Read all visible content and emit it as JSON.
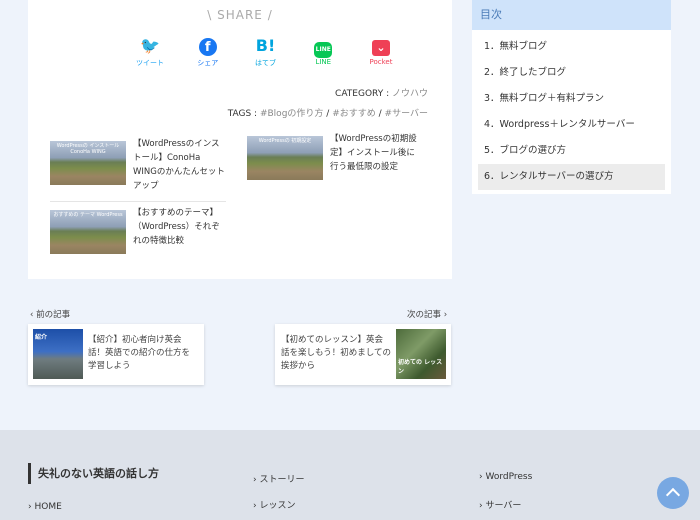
{
  "share": {
    "title": "\\ SHARE /",
    "buttons": [
      {
        "label": "ツイート",
        "icon": "twitter-icon",
        "glyph": "🐦"
      },
      {
        "label": "シェア",
        "icon": "facebook-icon",
        "glyph": "f"
      },
      {
        "label": "はてブ",
        "icon": "hatena-bookmark-icon",
        "glyph": "B!"
      },
      {
        "label": "LINE",
        "icon": "line-icon",
        "glyph": "LINE"
      },
      {
        "label": "Pocket",
        "icon": "pocket-icon",
        "glyph": "⌄"
      }
    ]
  },
  "category": {
    "label": "CATEGORY :",
    "value": "ノウハウ"
  },
  "tags": {
    "label": "TAGS :",
    "items": [
      "#Blogの作り方",
      "#おすすめ",
      "#サーバー"
    ],
    "separator": "/"
  },
  "related": [
    {
      "thumb_caption": "WordPressの インストール ConoHa WING",
      "title": "【WordPressのインストール】ConoHa WINGのかんたんセットアップ"
    },
    {
      "thumb_caption": "WordPressの 初期設定",
      "title": "【WordPressの初期設定】インストール後に行う最低限の設定"
    },
    {
      "thumb_caption": "おすすめの テーマ WordPress",
      "title": "【おすすめのテーマ】（WordPress）それぞれの特徴比較"
    }
  ],
  "post_nav": {
    "prev": {
      "label": "前の記事",
      "thumb_caption": "紹介",
      "title": "【紹介】初心者向け英会話！英語での紹介の仕方を学習しよう"
    },
    "next": {
      "label": "次の記事",
      "thumb_caption": "初めての レッスン",
      "title": "【初めてのレッスン】英会話を楽しもう！初めましての挨拶から"
    }
  },
  "toc": {
    "title": "目次",
    "items": [
      "1．無料ブログ",
      "2．終了したブログ",
      "3．無料ブログ＋有料プラン",
      "4．Wordpress＋レンタルサーバー",
      "5．ブログの選び方",
      "6．レンタルサーバーの選び方"
    ],
    "active_index": 5
  },
  "footer": {
    "site_title": "失礼のない英語の話し方",
    "links": [
      "HOME",
      "ストーリー",
      "レッスン",
      "WordPress",
      "サーバー"
    ]
  },
  "colors": {
    "accent": "#78a8e2",
    "toc_header": "#cfe3fa",
    "background": "#eef3fb"
  }
}
